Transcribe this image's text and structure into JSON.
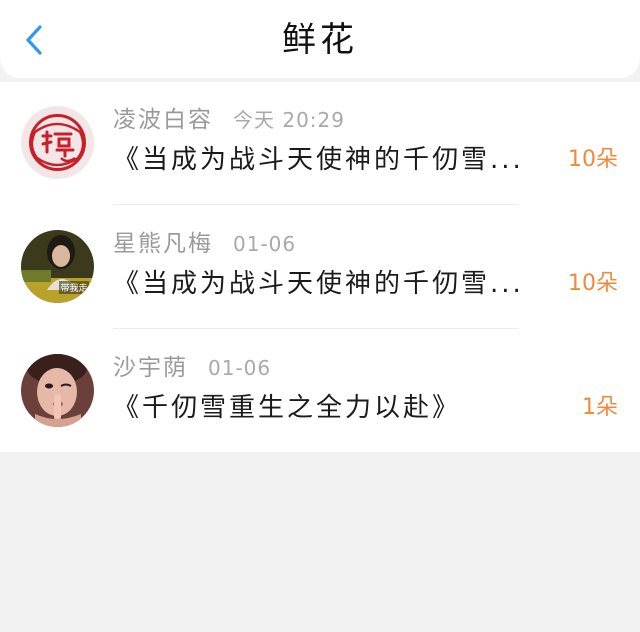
{
  "header": {
    "title": "鲜花",
    "back_icon": "chevron-left-icon",
    "accent": "#2f9bea"
  },
  "colors": {
    "flower_count": "#f08a3a",
    "meta_text": "#9a9a9a"
  },
  "records": [
    {
      "user": "凌波白容",
      "time": "今天 20:29",
      "book": "《当成为战斗天使神的千仞雪...",
      "flowers": "10朵",
      "avatar": "fu-character-avatar"
    },
    {
      "user": "星熊凡梅",
      "time": "01-06",
      "book": "《当成为战斗天使神的千仞雪...",
      "flowers": "10朵",
      "avatar": "photo-avatar",
      "avatar_text": "带我走"
    },
    {
      "user": "沙宇荫",
      "time": "01-06",
      "book": "《千仞雪重生之全力以赴》",
      "flowers": "1朵",
      "avatar": "photo-avatar"
    }
  ]
}
